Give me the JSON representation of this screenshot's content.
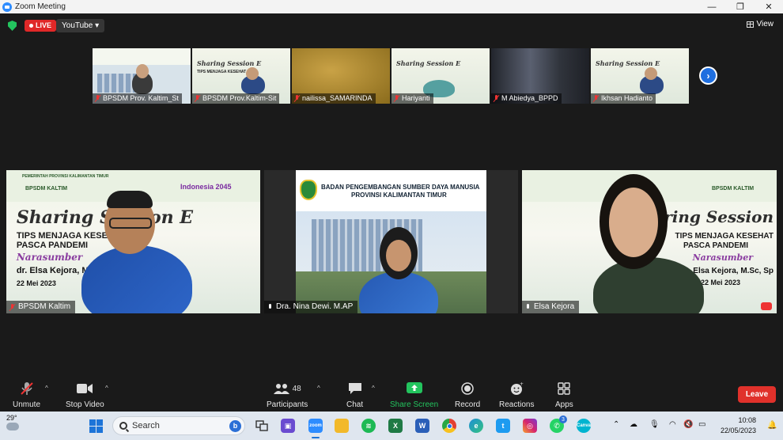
{
  "window": {
    "title": "Zoom Meeting",
    "controls": [
      "—",
      "❐",
      "✕"
    ]
  },
  "topbar": {
    "live_label": "LIVE",
    "stream_target": "YouTube ▾",
    "view_label": "View"
  },
  "thumbnails": [
    {
      "name": "BPSDM Prov. Kaltim_St",
      "muted": true
    },
    {
      "name": "BPSDM Prov.Kaltim-Sit",
      "muted": true
    },
    {
      "name": "nailissa_SAMARINDA",
      "muted": true
    },
    {
      "name": "Hariyanti",
      "muted": true
    },
    {
      "name": "M Abiedya_BPPD",
      "muted": true
    },
    {
      "name": "Ikhsan Hadianto",
      "muted": true
    }
  ],
  "tiles": [
    {
      "name": "BPSDM Kaltim",
      "muted": true,
      "slide": {
        "org": "PEMERINTAH PROVINSI KALIMANTAN TIMUR",
        "badge": "BPSDM KALTIM",
        "title": "Sharing Session E",
        "topic_1": "TIPS MENJAGA KESEHAT",
        "topic_2": "PASCA PANDEMI",
        "nara": "Narasumber",
        "speaker": "dr. Elsa Kejora, M",
        "date": "22 Mei 2023",
        "indonesia": "Indonesia 2045"
      }
    },
    {
      "name": "Dra. Nina Dewi. M.AP",
      "muted": false,
      "slide": {
        "org_1": "BADAN PENGEMBANGAN SUMBER DAYA MANUSIA",
        "org_2": "PROVINSI KALIMANTAN TIMUR"
      }
    },
    {
      "name": "Elsa Kejora",
      "muted": false,
      "slide": {
        "badge": "BPSDM KALTIM",
        "title": "Sharing Session",
        "topic_1": "TIPS MENJAGA KESEHAT",
        "topic_2": "PASCA PANDEMI",
        "nara": "Narasumber",
        "speaker": "dr. Elsa Kejora, M.Sc, Sp",
        "date": "22 Mei 2023"
      }
    }
  ],
  "toolbar": {
    "unmute": "Unmute",
    "stop_video": "Stop Video",
    "participants": "Participants",
    "participants_count": "48",
    "chat": "Chat",
    "share_screen": "Share Screen",
    "record": "Record",
    "reactions": "Reactions",
    "apps": "Apps",
    "leave": "Leave"
  },
  "taskbar": {
    "temperature": "29°",
    "search_placeholder": "Search",
    "time": "10:08",
    "date": "22/05/2023",
    "whatsapp_badge": "3",
    "apps": [
      {
        "icon": "task-view-icon",
        "color": "#4a4a4a"
      },
      {
        "icon": "meet-icon",
        "color": "#6a4bd0"
      },
      {
        "icon": "zoom-icon",
        "color": "#2d8cff"
      },
      {
        "icon": "folder-icon",
        "color": "#f2b92a"
      },
      {
        "icon": "spotify-icon",
        "color": "#1db954"
      },
      {
        "icon": "excel-icon",
        "color": "#1f7a45"
      },
      {
        "icon": "word-icon",
        "color": "#2b5fb8"
      },
      {
        "icon": "chrome-icon",
        "color": "#e34133"
      },
      {
        "icon": "edge-icon",
        "color": "#1d8fd6"
      },
      {
        "icon": "twitter-icon",
        "color": "#1d9bf0"
      },
      {
        "icon": "instagram-icon",
        "color": "#d6246e"
      },
      {
        "icon": "whatsapp-icon",
        "color": "#25d366"
      },
      {
        "icon": "canva-icon",
        "color": "#00b4d0"
      }
    ]
  }
}
